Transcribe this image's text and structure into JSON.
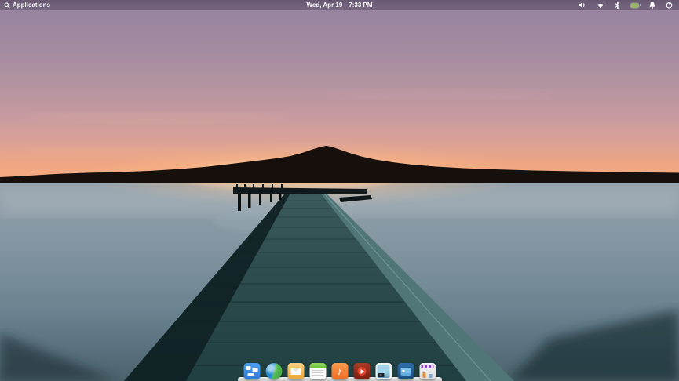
{
  "desktop": {
    "environment": "elementary OS Pantheon desktop",
    "wallpaper": {
      "description": "Sunset over calm lake with wooden pier and tree-lined horizon",
      "colors": {
        "sky_top": "#95829e",
        "sky_pink": "#c79ba0",
        "sky_orange": "#f2a47e",
        "horizon_glow": "#f9b184",
        "treeline_silhouette": "#170f0b",
        "water_top": "#98a5ad",
        "water_bottom": "#4c626c",
        "pier_deck": "#2b4a4c",
        "pier_edge_dark": "#122224",
        "pier_rail_light": "#51787a"
      }
    }
  },
  "top_panel": {
    "app_menu": {
      "label": "Applications",
      "icon": "search"
    },
    "clock": {
      "date": "Wed, Apr 19",
      "time": "7:33 PM"
    },
    "indicators": [
      {
        "name": "sound",
        "icon": "speaker"
      },
      {
        "name": "network",
        "icon": "wifi"
      },
      {
        "name": "bluetooth",
        "icon": "bluetooth"
      },
      {
        "name": "battery",
        "icon": "battery-full",
        "color": "#97b264"
      },
      {
        "name": "notifications",
        "icon": "bell"
      },
      {
        "name": "session",
        "icon": "power"
      }
    ]
  },
  "dock": {
    "items": [
      {
        "name": "multitasking-view",
        "color": "#3689e6"
      },
      {
        "name": "web-browser",
        "color": "#3d9fd6"
      },
      {
        "name": "mail",
        "color": "#efb140"
      },
      {
        "name": "calendar",
        "color": "#f5f5f5"
      },
      {
        "name": "music",
        "color": "#f37329"
      },
      {
        "name": "videos",
        "color": "#99261a"
      },
      {
        "name": "photos",
        "color": "#8fc4d9"
      },
      {
        "name": "display-settings",
        "color": "#2b6ea3"
      },
      {
        "name": "appcenter",
        "color": "#e6e6e6"
      }
    ]
  }
}
